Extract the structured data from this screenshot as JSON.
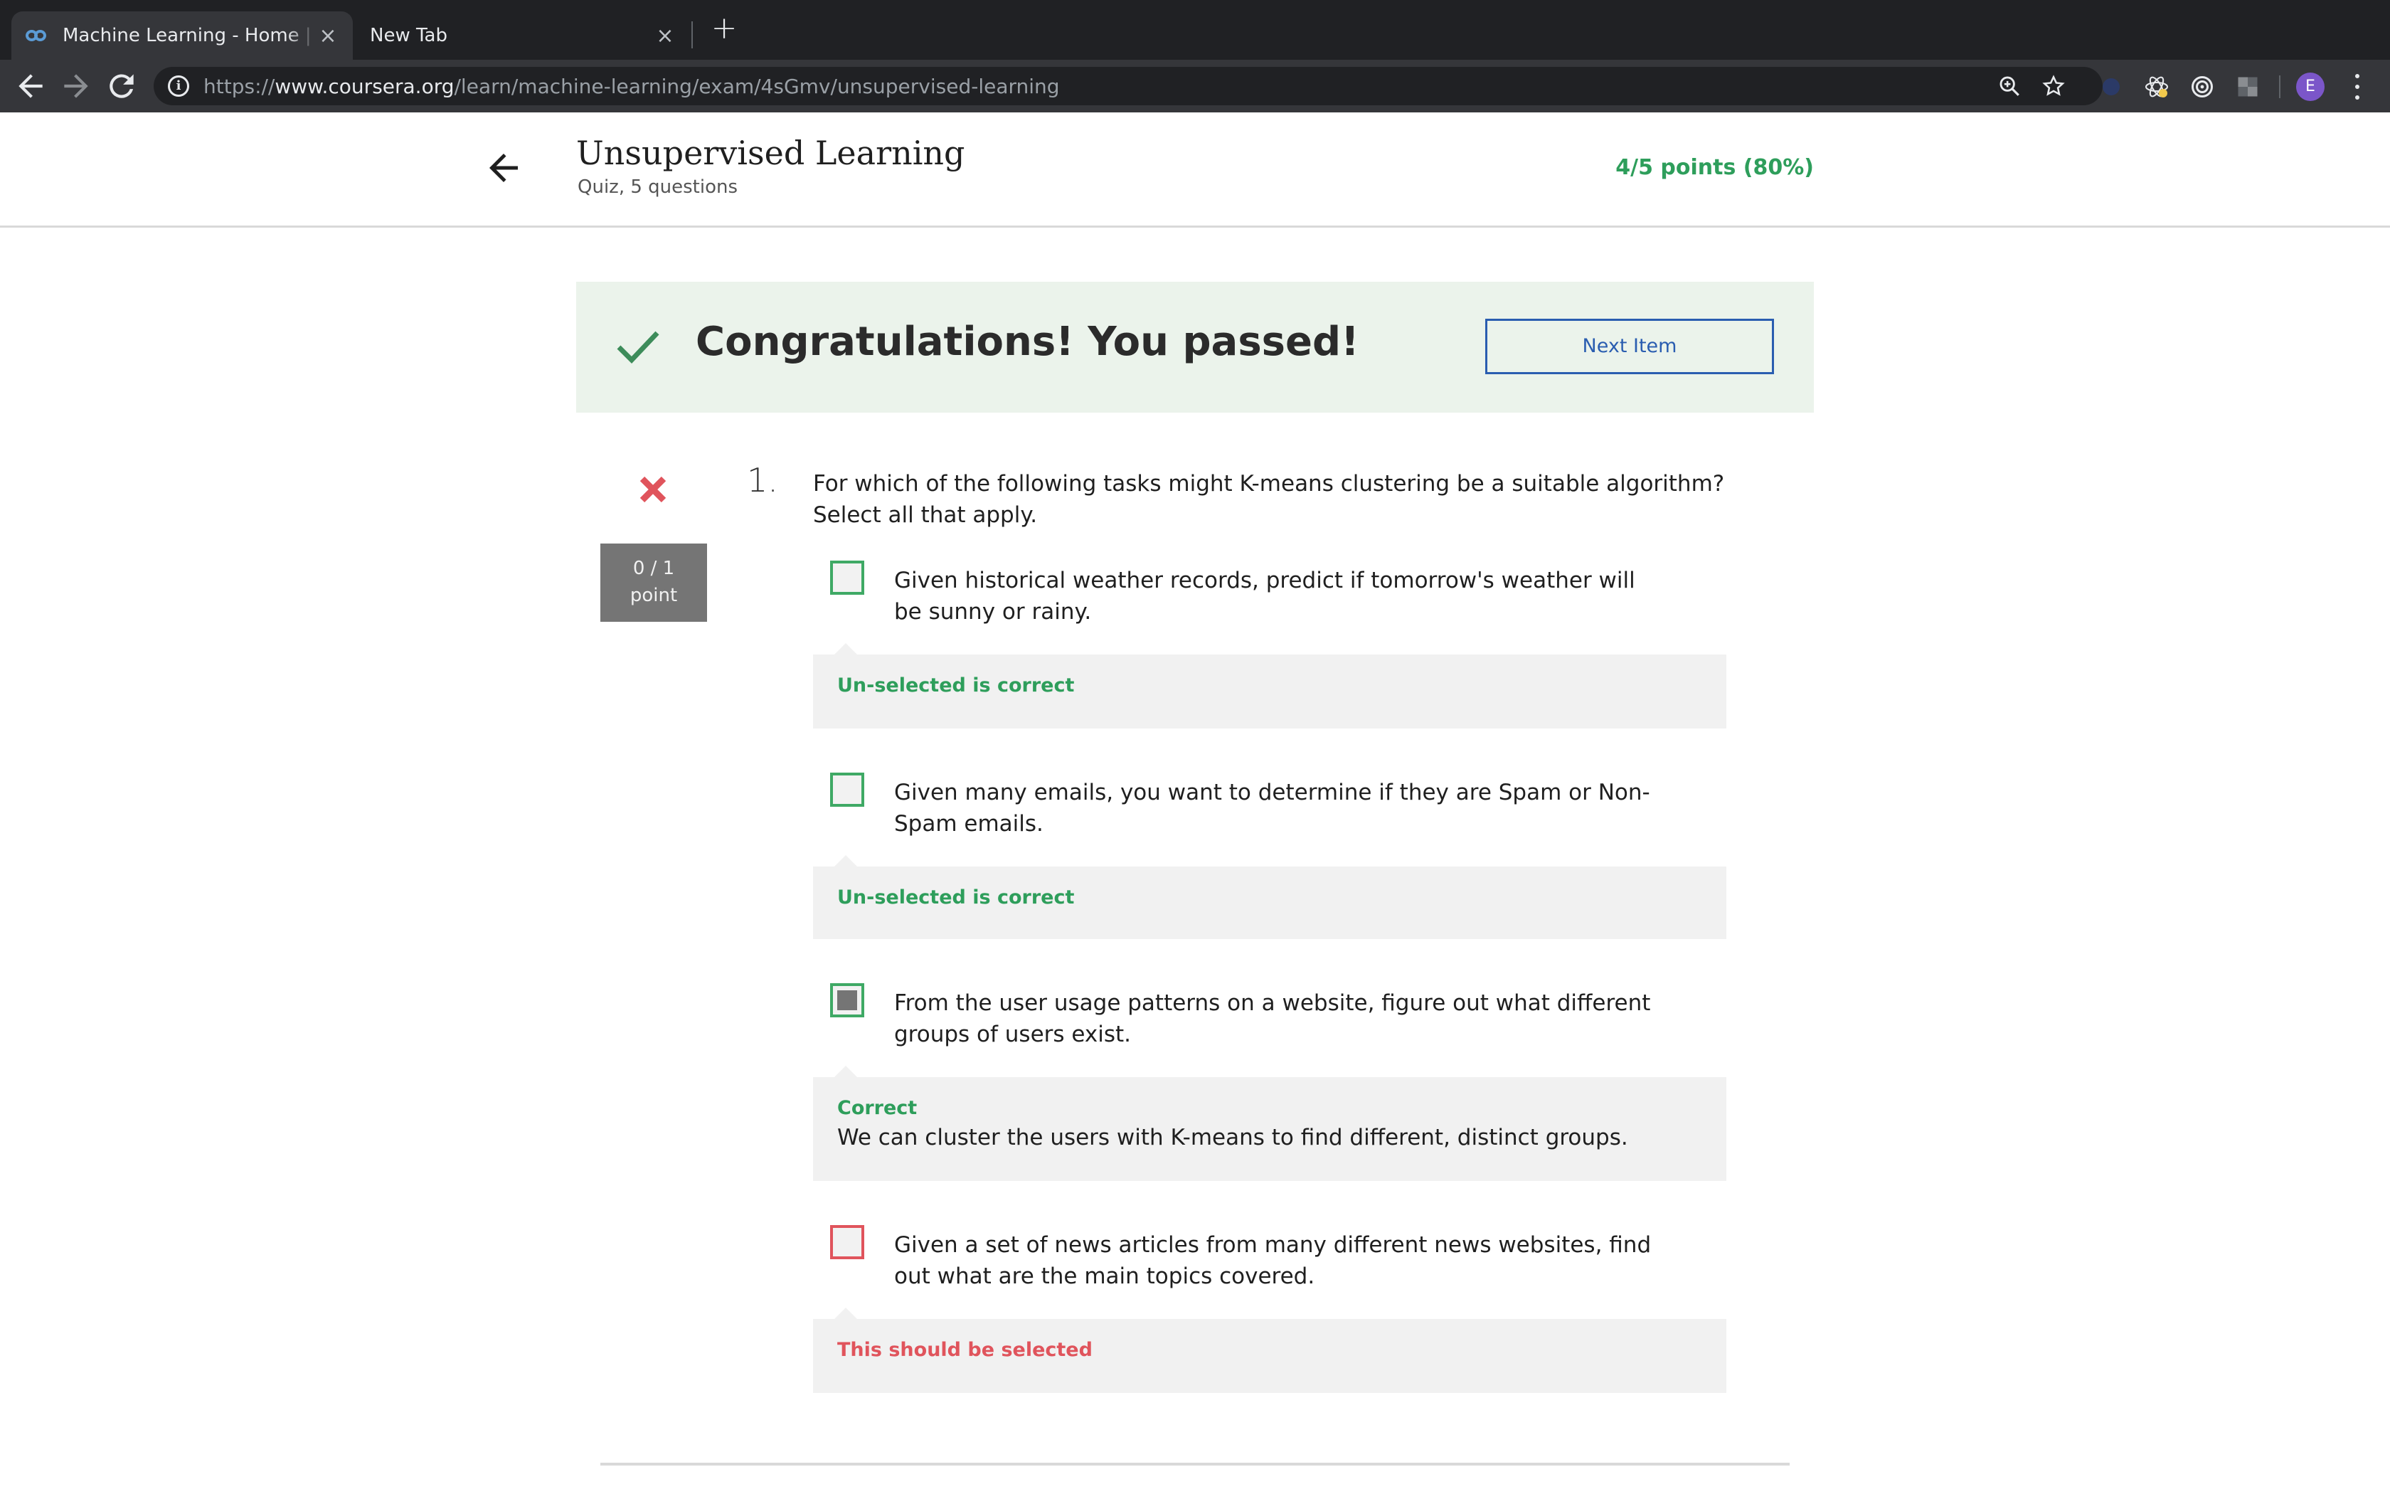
{
  "browser": {
    "tabs": [
      {
        "title": "Machine Learning - Home | Coursera",
        "close": "×"
      },
      {
        "title": "New Tab",
        "close": "×"
      }
    ],
    "new_tab": "+",
    "url": {
      "scheme": "https://",
      "host": "www.coursera.org",
      "path": "/learn/machine-learning/exam/4sGmv/unsupervised-learning"
    },
    "avatar_initial": "E"
  },
  "header": {
    "title": "Unsupervised Learning",
    "subtitle": "Quiz, 5 questions",
    "points": "4/5 points (80%)"
  },
  "banner": {
    "message": "Congratulations! You passed!",
    "next_button": "Next Item"
  },
  "question": {
    "number": "1.",
    "score_line1": "0 / 1",
    "score_line2": "point",
    "text": "For which of the following tasks might K-means clustering be a suitable algorithm? Select all that apply.",
    "options": [
      {
        "text": "Given historical weather records, predict if tomorrow's weather will be sunny or rainy.",
        "checked": false,
        "feedback_label": "Un-selected is correct",
        "feedback_text": "",
        "status": "correct"
      },
      {
        "text": "Given many emails, you want to determine if they are Spam or Non-Spam emails.",
        "checked": false,
        "feedback_label": "Un-selected is correct",
        "feedback_text": "",
        "status": "correct"
      },
      {
        "text": "From the user usage patterns on a website, figure out what different groups of users exist.",
        "checked": true,
        "feedback_label": "Correct",
        "feedback_text": "We can cluster the users with K-means to find different, distinct groups.",
        "status": "correct"
      },
      {
        "text": "Given a set of news articles from many different news websites, find out what are the main topics covered.",
        "checked": false,
        "feedback_label": "This should be selected",
        "feedback_text": "",
        "status": "incorrect"
      }
    ]
  },
  "colors": {
    "success_green": "#2e9e5b",
    "error_red": "#e0545c",
    "link_blue": "#2a5db0",
    "banner_bg": "#ebf3eb"
  }
}
